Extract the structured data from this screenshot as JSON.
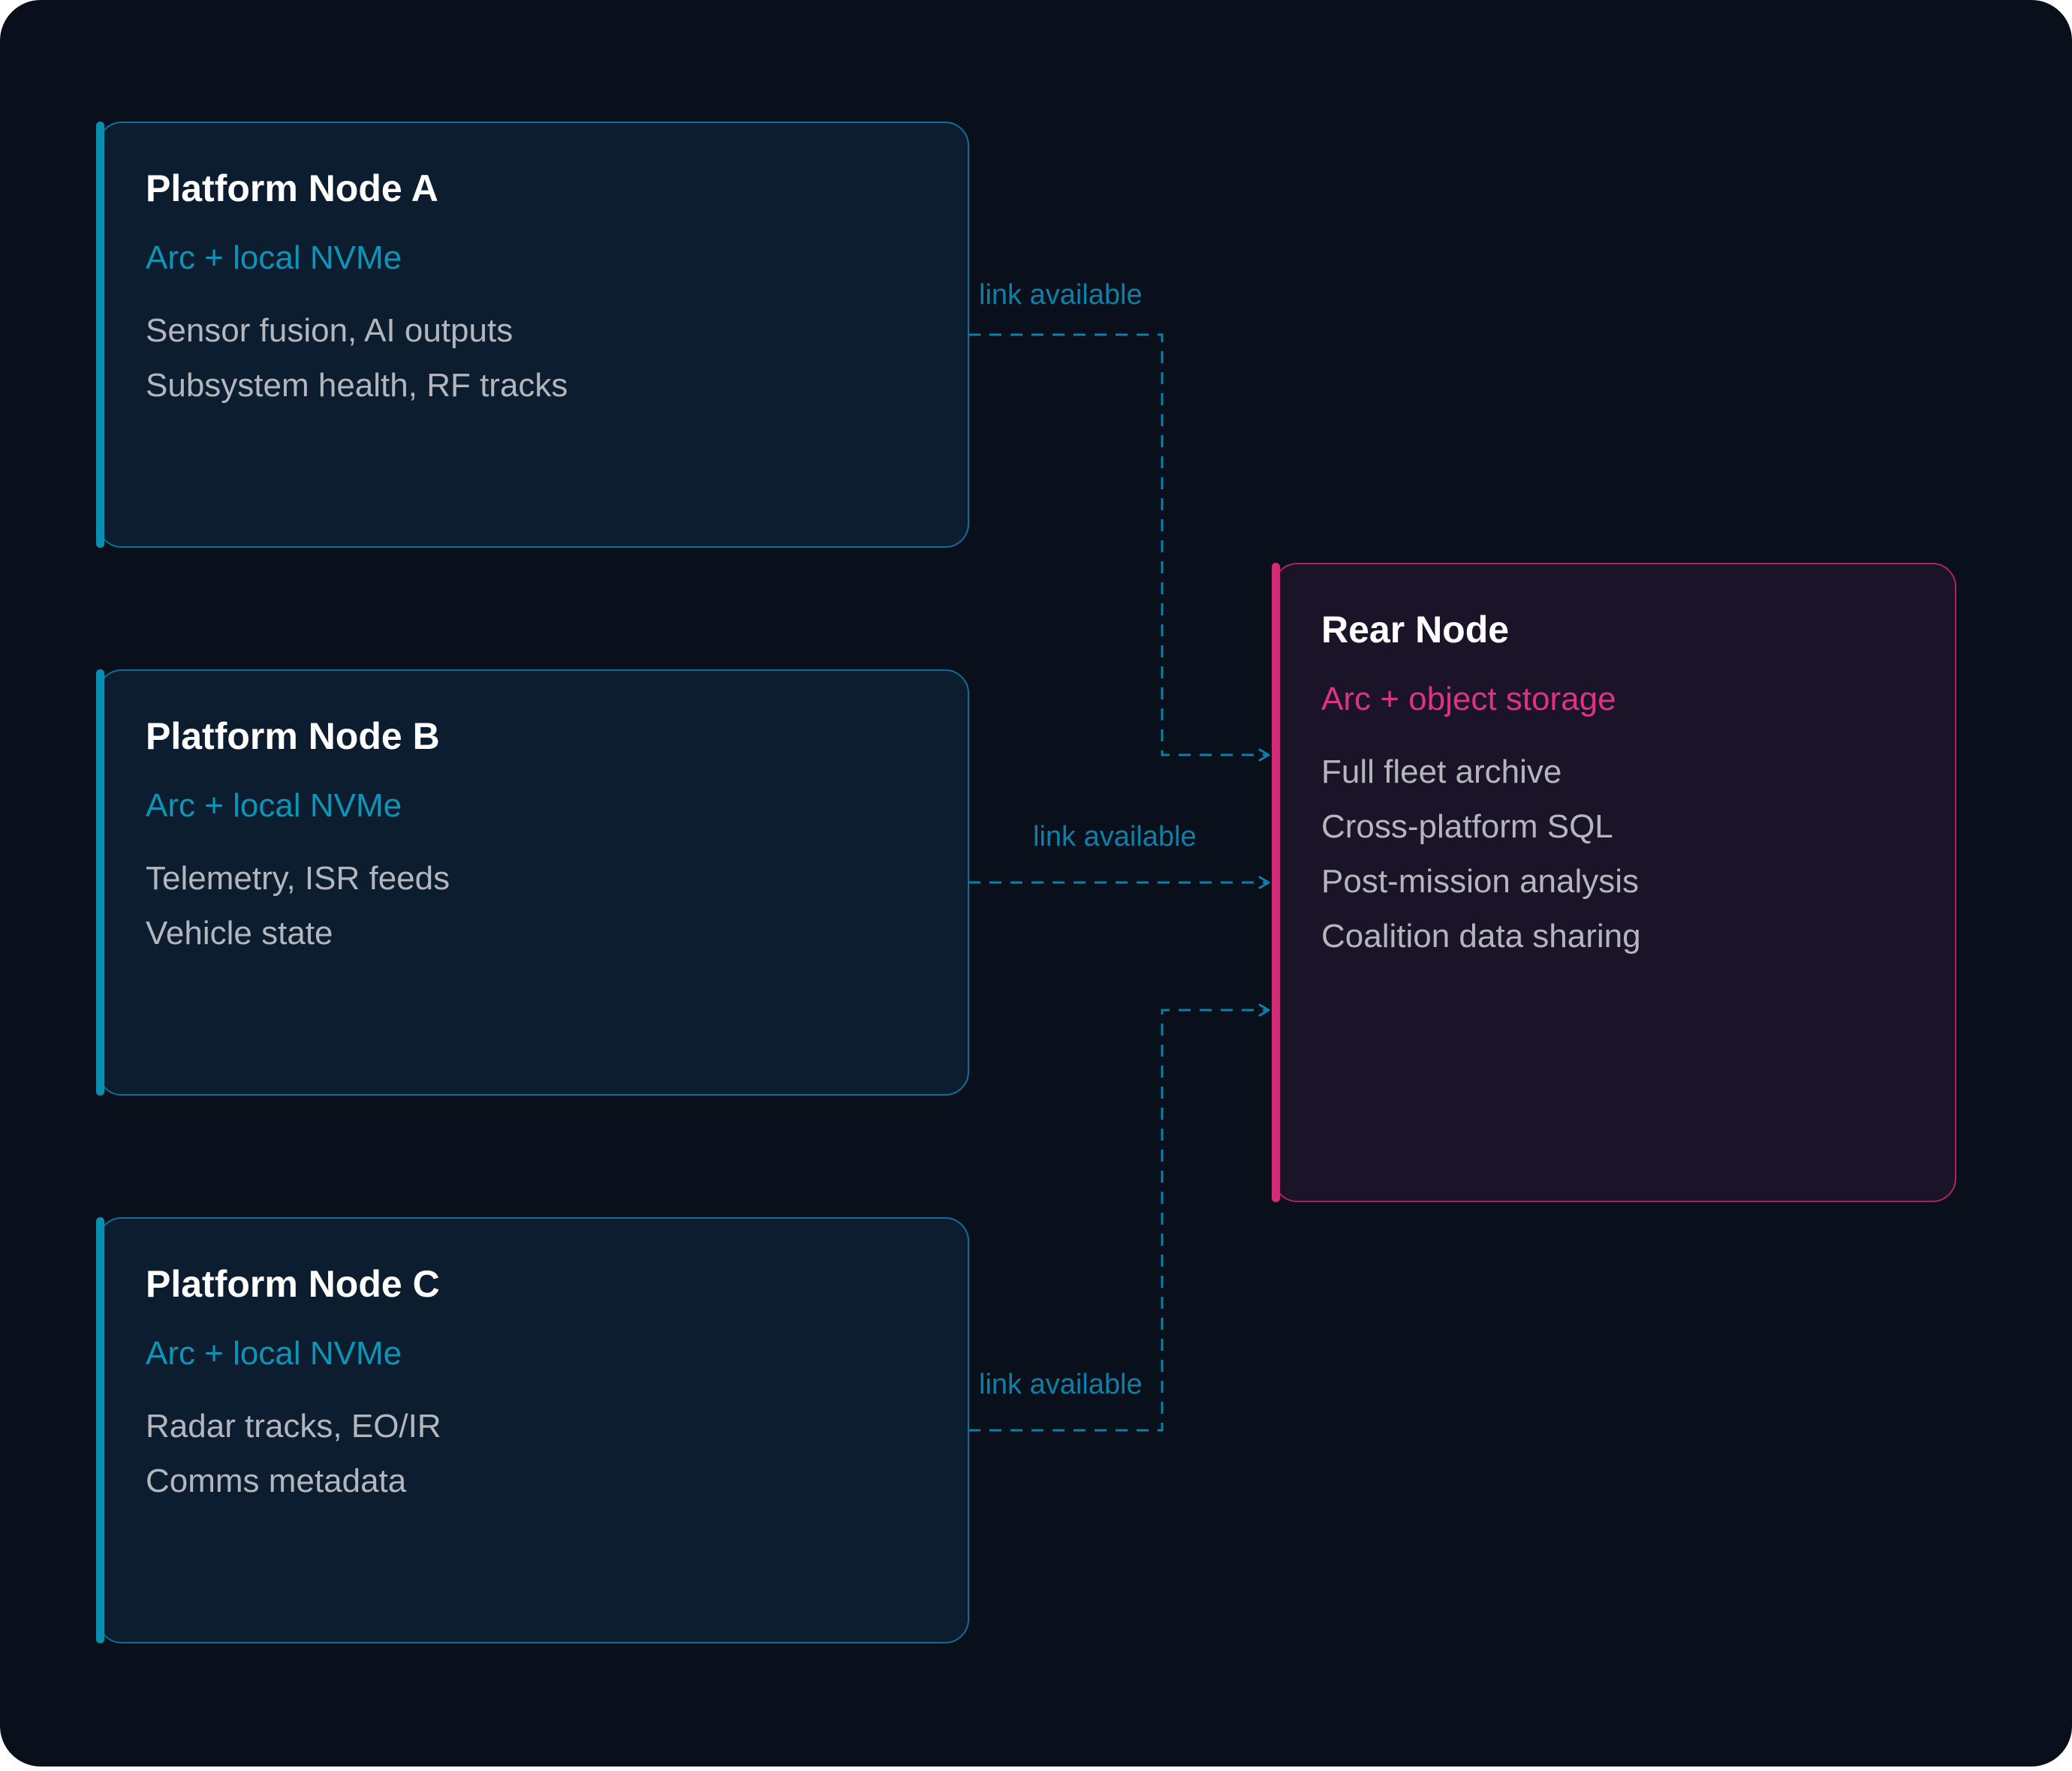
{
  "platform_nodes": [
    {
      "title": "Platform Node A",
      "storage": "Arc + local NVMe",
      "lines": [
        "Sensor fusion, AI outputs",
        "Subsystem health, RF tracks"
      ]
    },
    {
      "title": "Platform Node B",
      "storage": "Arc + local NVMe",
      "lines": [
        "Telemetry, ISR feeds",
        "Vehicle state"
      ]
    },
    {
      "title": "Platform Node C",
      "storage": "Arc + local NVMe",
      "lines": [
        "Radar tracks, EO/IR",
        "Comms metadata"
      ]
    }
  ],
  "rear_node": {
    "title": "Rear Node",
    "storage": "Arc + object storage",
    "lines": [
      "Full fleet archive",
      "Cross-platform SQL",
      "Post-mission analysis",
      "Coalition data sharing"
    ]
  },
  "links": [
    {
      "from": "Platform Node A",
      "to": "Rear Node",
      "label": "link available"
    },
    {
      "from": "Platform Node B",
      "to": "Rear Node",
      "label": "link available"
    },
    {
      "from": "Platform Node C",
      "to": "Rear Node",
      "label": "link available"
    }
  ],
  "colors": {
    "background": "#0a0f1c",
    "platform_accent": "#0b8db0",
    "rear_accent": "#d02c78",
    "link": "#0e7fa5"
  }
}
